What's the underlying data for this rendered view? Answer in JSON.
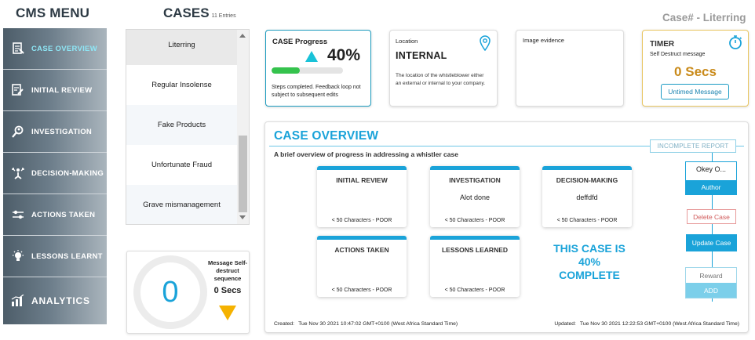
{
  "sidebar": {
    "title": "CMS MENU",
    "items": [
      {
        "label": "CASE OVERVIEW",
        "icon": "document-icon",
        "active": true
      },
      {
        "label": "INITIAL REVIEW",
        "icon": "edit-document-icon",
        "active": false
      },
      {
        "label": "INVESTIGATION",
        "icon": "magnifier-person-icon",
        "active": false
      },
      {
        "label": "DECISION-MAKING",
        "icon": "arrows-person-icon",
        "active": false
      },
      {
        "label": "ACTIONS TAKEN",
        "icon": "sliders-icon",
        "active": false
      },
      {
        "label": "LESSONS LEARNT",
        "icon": "lightbulb-icon",
        "active": false
      },
      {
        "label": "ANALYTICS",
        "icon": "bar-chart-icon",
        "active": false
      }
    ]
  },
  "cases": {
    "title": "CASES",
    "count_label": "11 Entries",
    "items": [
      {
        "label": "Literring"
      },
      {
        "label": "Regular Insolense"
      },
      {
        "label": "Fake Products"
      },
      {
        "label": "Unfortunate Fraud"
      },
      {
        "label": "Grave mismanagement"
      }
    ],
    "scroll_position": 0.6
  },
  "self_destruct": {
    "count": "0",
    "message": "Message Self-destruct sequence",
    "seconds": "0 Secs"
  },
  "case_heading": "Case# - Literring",
  "progress_card": {
    "label": "CASE Progress",
    "percent": "40%",
    "progress_fraction": 0.4,
    "note": "Steps completed. Feedback loop not subject to subsequent edits"
  },
  "location_card": {
    "label": "Location",
    "value": "INTERNAL",
    "description": "The location of the whistleblower either an external or internal to your company."
  },
  "evidence_card": {
    "label": "Image evidence"
  },
  "timer_card": {
    "title": "TIMER",
    "subtitle": "Self Destruct message",
    "seconds": "0 Secs",
    "button": "Untimed Message"
  },
  "overview": {
    "title": "CASE OVERVIEW",
    "subtitle": "A brief overview of progress in addressing a whistler case",
    "badge": "INCOMPLETE REPORT",
    "stages": [
      {
        "title": "INITIAL REVIEW",
        "text": "",
        "footer": "< 50 Characters - POOR"
      },
      {
        "title": "INVESTIGATION",
        "text": "Alot done",
        "footer": "< 50 Characters - POOR"
      },
      {
        "title": "DECISION-MAKING",
        "text": "deffdfd",
        "footer": "< 50 Characters - POOR"
      },
      {
        "title": "ACTIONS TAKEN",
        "text": "",
        "footer": "< 50 Characters - POOR"
      },
      {
        "title": "LESSONS LEARNED",
        "text": "",
        "footer": "< 50 Characters - POOR"
      }
    ],
    "complete_text": "THIS CASE IS 40% COMPLETE",
    "author_value": "Okey O...",
    "author_label": "Author",
    "delete_label": "Delete Case",
    "update_label": "Update Case",
    "reward_placeholder": "Reward",
    "add_label": "ADD",
    "created_label": "Created:",
    "created_value": "Tue Nov 30 2021 10:47:02 GMT+0100 (West Africa Standard Time)",
    "updated_label": "Updated:",
    "updated_value": "Tue Nov 30 2021 12:22:53 GMT+0100 (West Africa Standard Time)"
  },
  "colors": {
    "accent": "#1aa3d9",
    "progress_green": "#35c34d",
    "timer_gold": "#c98a1a",
    "warning_yellow": "#f5b200",
    "delete_red": "#d05a5a"
  }
}
